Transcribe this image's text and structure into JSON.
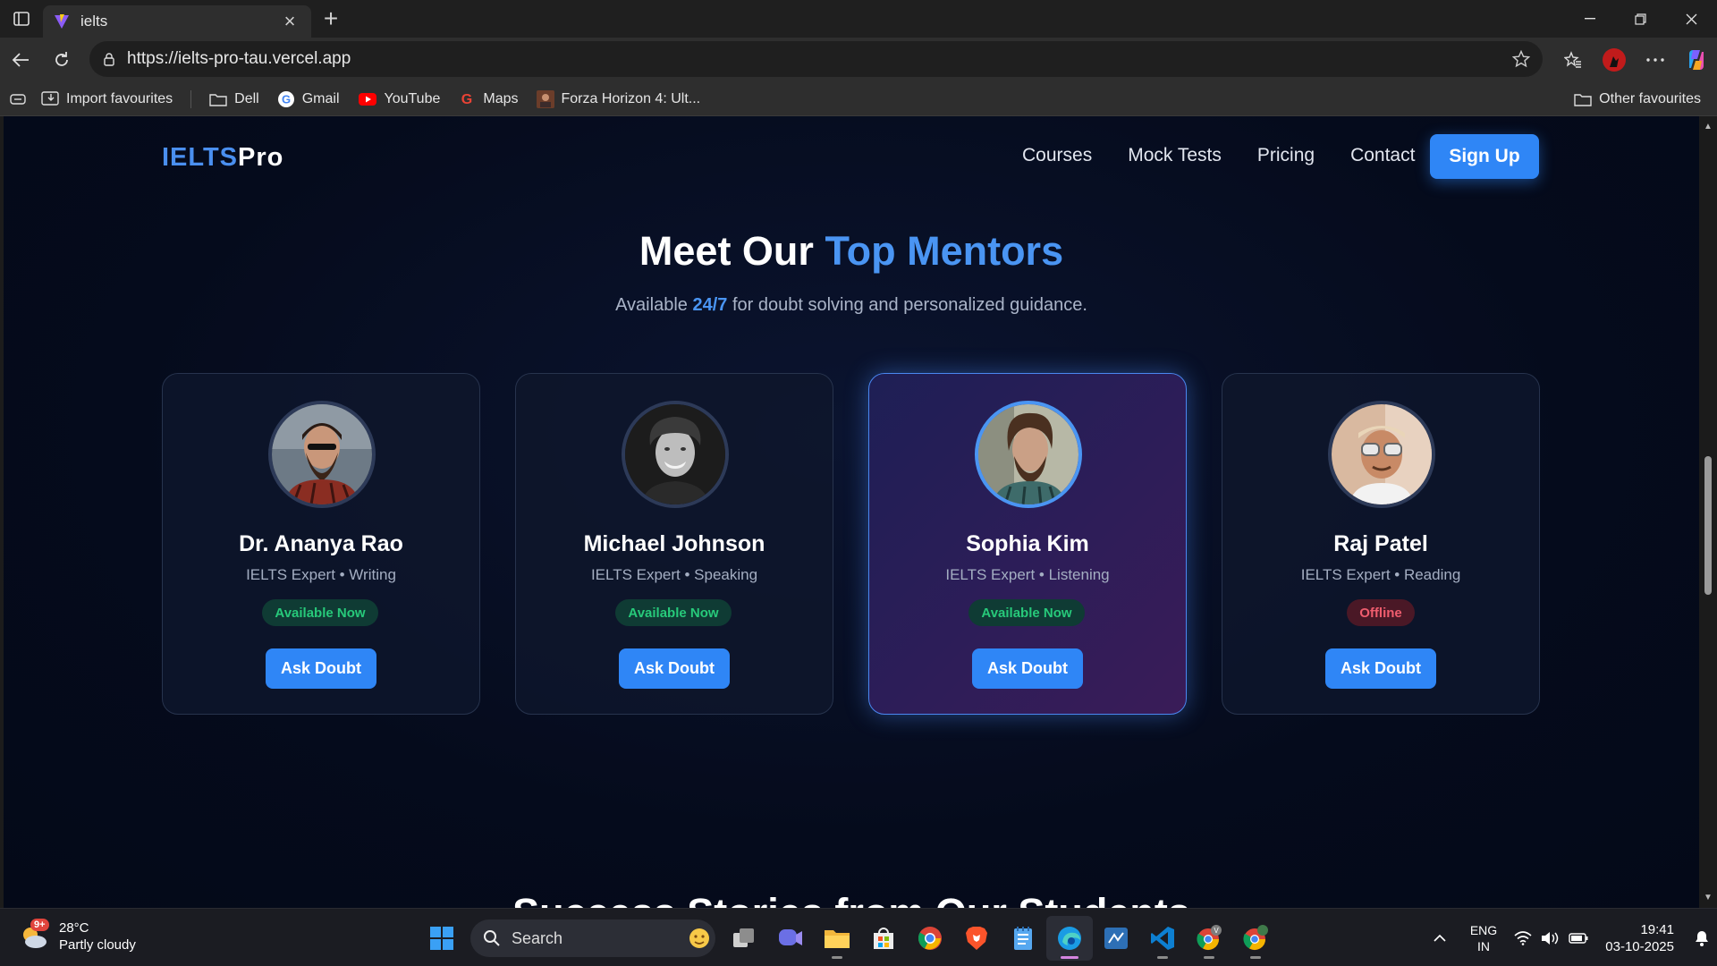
{
  "browser": {
    "tab_title": "ielts",
    "url": "https://ielts-pro-tau.vercel.app",
    "bookmarks": [
      "Import favourites",
      "Dell",
      "Gmail",
      "YouTube",
      "Maps",
      "Forza Horizon 4: Ult..."
    ],
    "other_favourites": "Other favourites"
  },
  "site": {
    "brand_a": "IELTS",
    "brand_b": "Pro",
    "nav": [
      "Courses",
      "Mock Tests",
      "Pricing",
      "Contact"
    ],
    "signup": "Sign Up",
    "heading_a": "Meet Our",
    "heading_b": "Top Mentors",
    "sub_a": "Available",
    "sub_hl": "24/7",
    "sub_b": "for doubt solving and personalized guidance.",
    "mentors": [
      {
        "name": "Dr. Ananya Rao",
        "role": "IELTS Expert • Writing",
        "status": "Available Now",
        "button": "Ask Doubt"
      },
      {
        "name": "Michael Johnson",
        "role": "IELTS Expert • Speaking",
        "status": "Available Now",
        "button": "Ask Doubt"
      },
      {
        "name": "Sophia Kim",
        "role": "IELTS Expert • Listening",
        "status": "Available Now",
        "button": "Ask Doubt"
      },
      {
        "name": "Raj Patel",
        "role": "IELTS Expert • Reading",
        "status": "Offline",
        "button": "Ask Doubt"
      }
    ],
    "next_heading": "Success Stories from Our Students"
  },
  "taskbar": {
    "temp": "28°C",
    "weather": "Partly cloudy",
    "weather_badge": "9+",
    "search": "Search",
    "lang_a": "ENG",
    "lang_b": "IN",
    "time": "19:41",
    "date": "03-10-2025"
  },
  "colors": {
    "accent": "#2f86f6",
    "available": "#27c97a",
    "offline": "#ef5d6e"
  }
}
